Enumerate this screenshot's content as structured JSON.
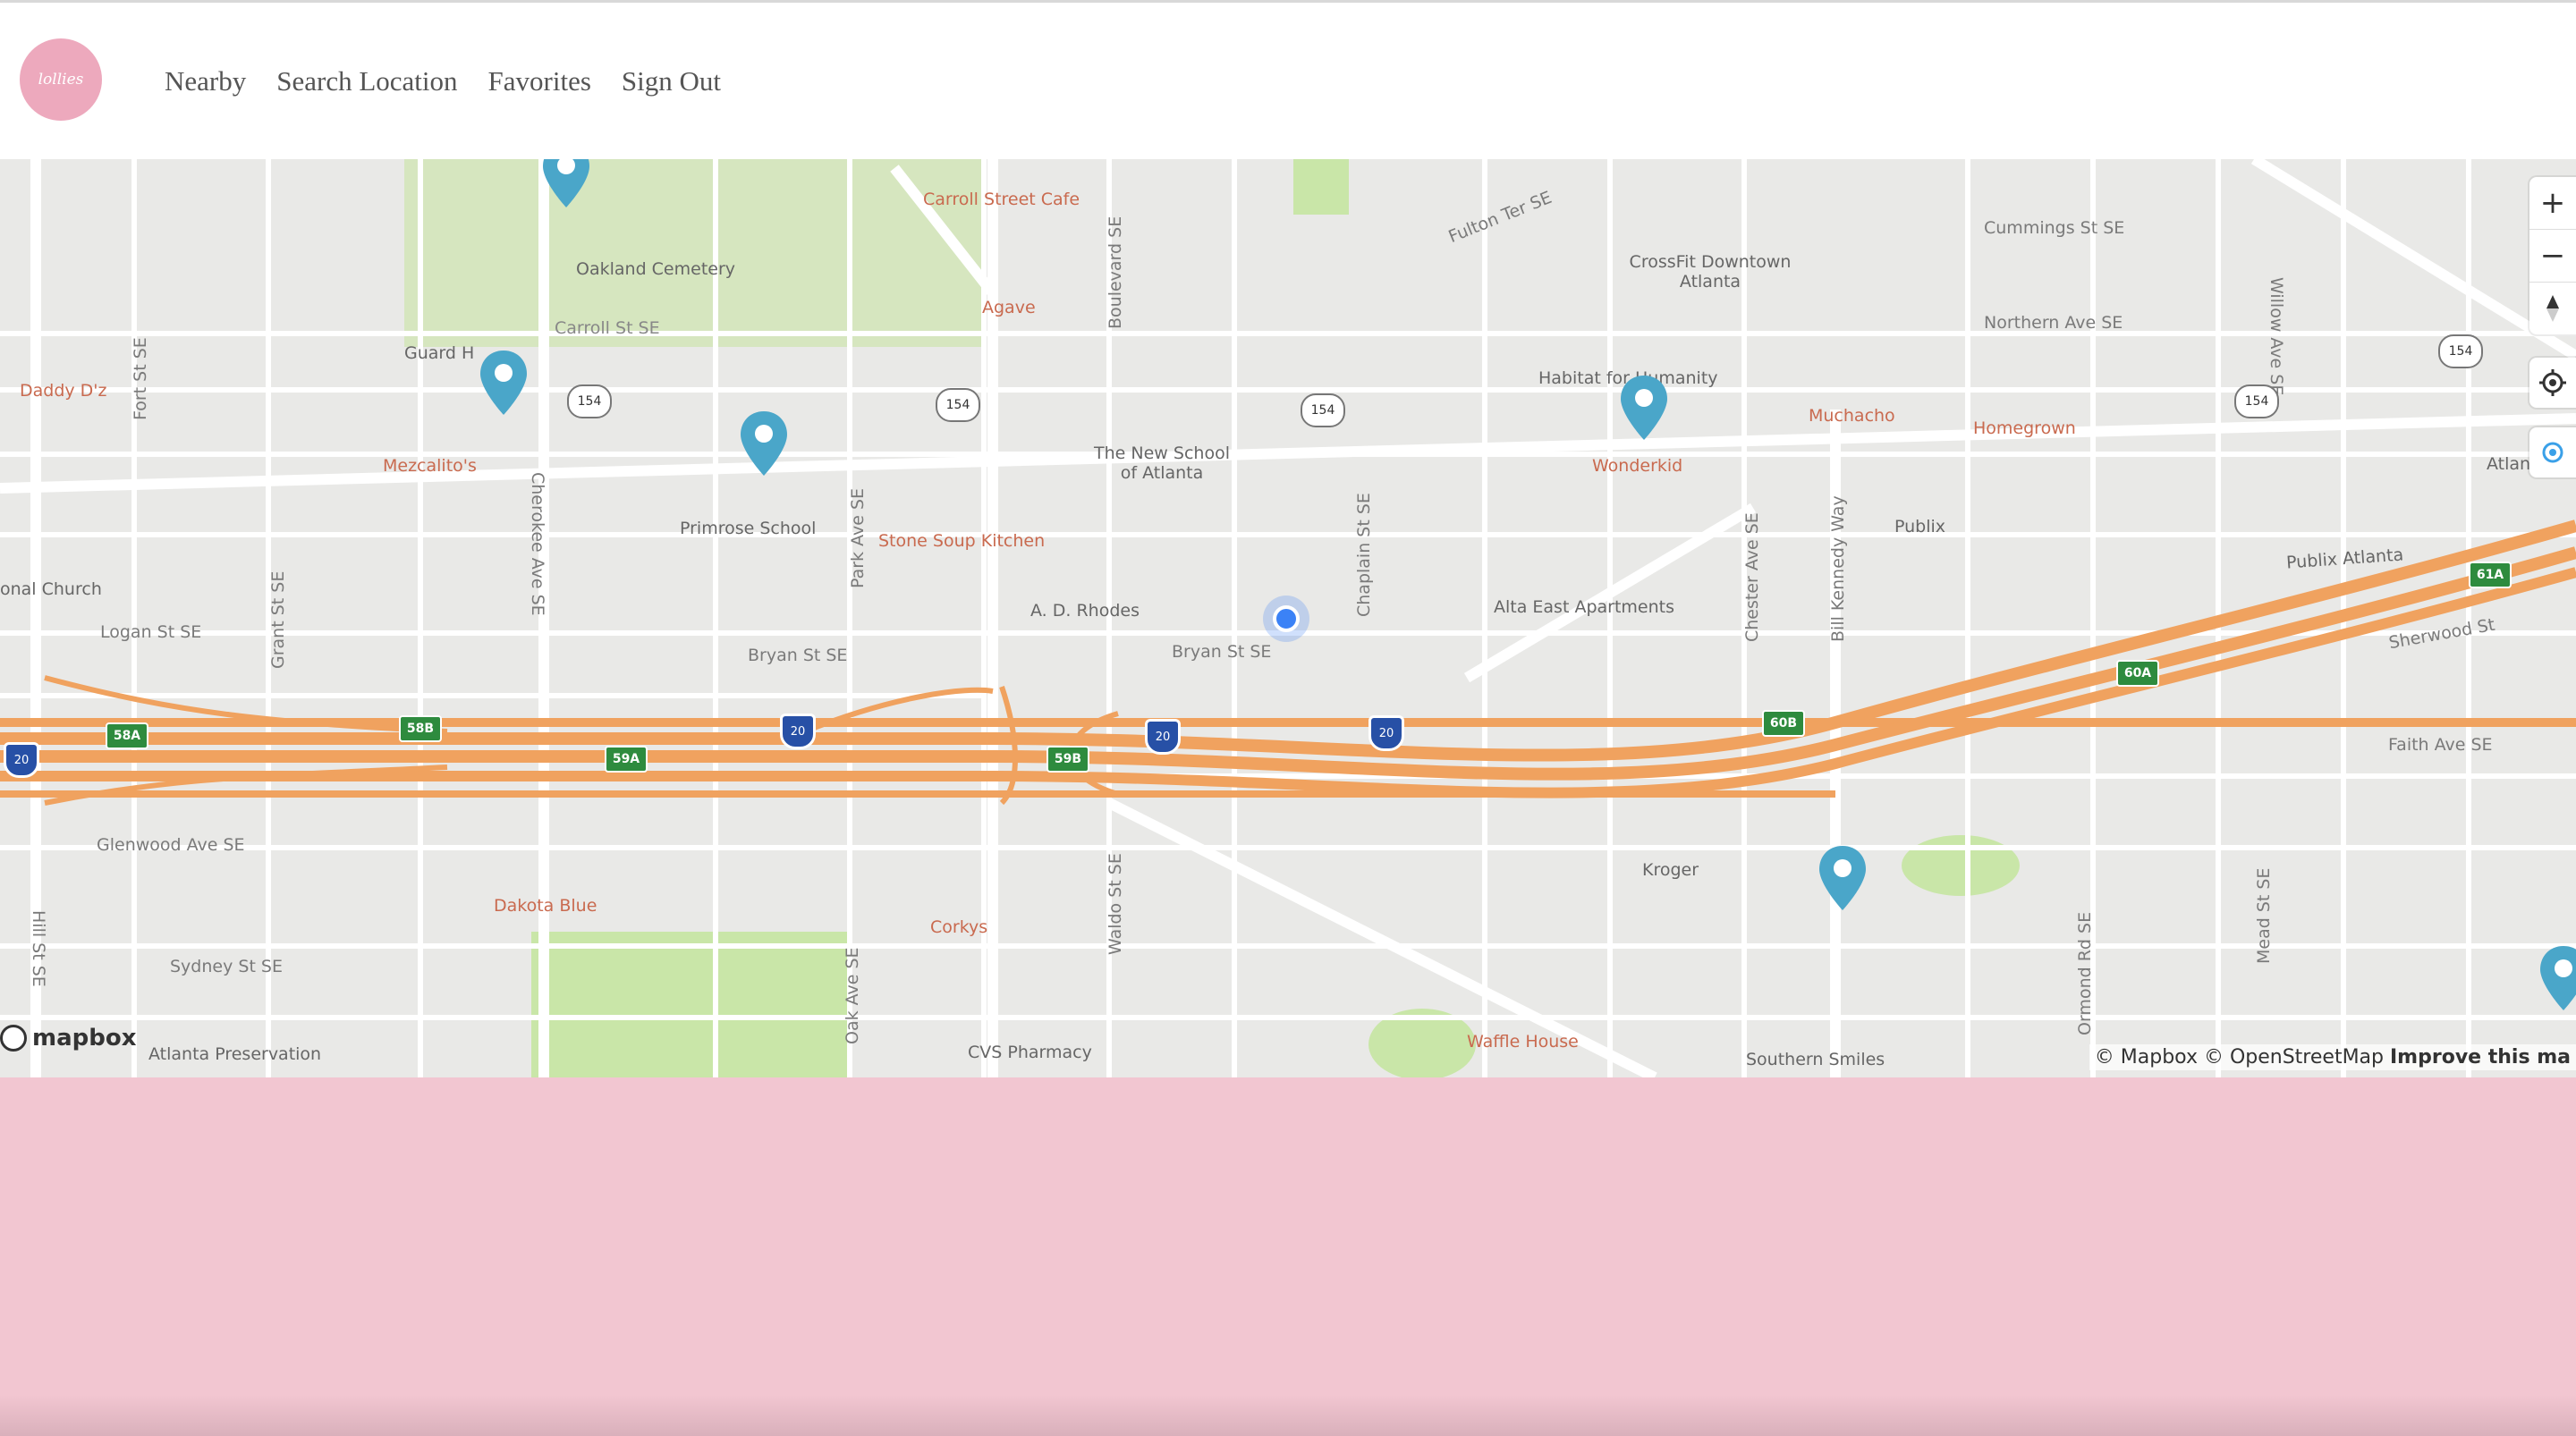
{
  "app": {
    "logo_text": "lollies"
  },
  "nav": {
    "items": [
      {
        "label": "Nearby"
      },
      {
        "label": "Search Location"
      },
      {
        "label": "Favorites"
      },
      {
        "label": "Sign Out"
      }
    ]
  },
  "map": {
    "controls": {
      "zoom_in": "+",
      "zoom_out": "−"
    },
    "attribution_left": "mapbox",
    "attribution_right_plain": "© Mapbox © OpenStreetMap",
    "attribution_right_bold": "Improve this ma",
    "labels": {
      "poi": [
        "Carroll Street Cafe",
        "Daddy D'z",
        "Mezcalito's",
        "Agave",
        "Stone Soup Kitchen",
        "Wonderkid",
        "Muchacho",
        "Homegrown",
        "Dakota Blue",
        "Corkys",
        "Waffle House",
        "CVS Pharmacy",
        "Southern Smiles"
      ],
      "places": [
        "Oakland Cemetery",
        "Guard H",
        "Primrose School",
        "The New School of Atlanta",
        "A. D. Rhodes",
        "CrossFit Downtown Atlanta",
        "Habitat for Humanity",
        "Publix",
        "Alta East Apartments",
        "Kroger",
        "Atlanta Preservation",
        "Publix Atlanta",
        "Atlanta",
        "onal Church"
      ],
      "streets": [
        "Carroll St SE",
        "Fort St SE",
        "Grant St SE",
        "Cherokee Ave SE",
        "Park Ave SE",
        "Boulevard SE",
        "Chaplain St SE",
        "Bill Kennedy Way",
        "Chester Ave SE",
        "Logan St SE",
        "Bryan St SE",
        "Bryan St SE",
        "Glenwood Ave SE",
        "Sydney St SE",
        "Hill St SE",
        "Fulton Ter SE",
        "Cummings St SE",
        "Northern Ave SE",
        "Willow Ave SE",
        "Faith Ave SE",
        "Sherwood St",
        "Waldo St SE",
        "Oak Ave SE",
        "Ormond Rd SE",
        "Mead St SE"
      ],
      "route_shields": [
        "154",
        "154",
        "154",
        "154",
        "154",
        "154"
      ],
      "exit_shields": [
        "58A",
        "58B",
        "59A",
        "59B",
        "61A",
        "60B",
        "60A"
      ],
      "interstate_shields": [
        "20",
        "20",
        "20",
        "20"
      ]
    }
  },
  "colors": {
    "pin": "#4aa6c9",
    "highway": "#f0a25f",
    "brand_pink": "#f2c6d1",
    "park": "#c9e6a8"
  }
}
